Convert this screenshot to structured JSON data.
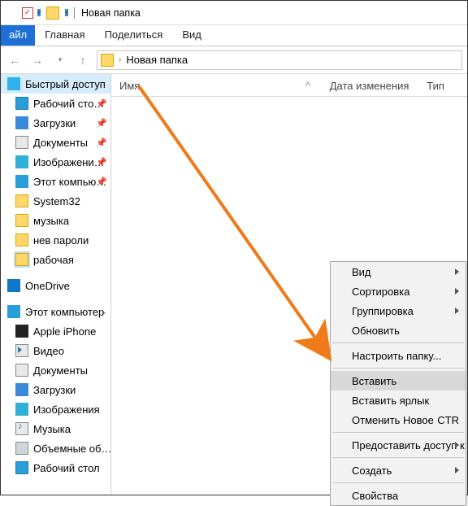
{
  "window": {
    "title": "Новая папка"
  },
  "ribbon": {
    "file": "айл",
    "tabs": [
      "Главная",
      "Поделиться",
      "Вид"
    ]
  },
  "address": {
    "path": "Новая папка"
  },
  "columns": {
    "name": "Имя",
    "date": "Дата изменения",
    "type": "Тип",
    "sort_indicator": "^"
  },
  "sidebar": {
    "quick": {
      "label": "Быстрый доступ"
    },
    "quick_items": [
      {
        "label": "Рабочий сто…",
        "pin": true,
        "icon": "desk"
      },
      {
        "label": "Загрузки",
        "pin": true,
        "icon": "down"
      },
      {
        "label": "Документы",
        "pin": true,
        "icon": "docs"
      },
      {
        "label": "Изображени…",
        "pin": true,
        "icon": "pics"
      },
      {
        "label": "Этот компью…",
        "pin": true,
        "icon": "pc"
      },
      {
        "label": "System32",
        "pin": false,
        "icon": "fold"
      },
      {
        "label": "музыка",
        "pin": false,
        "icon": "fold"
      },
      {
        "label": "нев пароли",
        "pin": false,
        "icon": "fold"
      },
      {
        "label": "рабочая",
        "pin": false,
        "icon": "fold",
        "selected": true
      }
    ],
    "onedrive": {
      "label": "OneDrive"
    },
    "thispc": {
      "label": "Этот компьютер"
    },
    "pc_items": [
      {
        "label": "Apple iPhone",
        "icon": "iph"
      },
      {
        "label": "Видео",
        "icon": "vid"
      },
      {
        "label": "Документы",
        "icon": "docs"
      },
      {
        "label": "Загрузки",
        "icon": "down"
      },
      {
        "label": "Изображения",
        "icon": "pics"
      },
      {
        "label": "Музыка",
        "icon": "mus"
      },
      {
        "label": "Объемные об…",
        "icon": "hdd"
      },
      {
        "label": "Рабочий стол",
        "icon": "desk"
      }
    ]
  },
  "context_menu": {
    "items": [
      {
        "label": "Вид",
        "sub": true
      },
      {
        "label": "Сортировка",
        "sub": true
      },
      {
        "label": "Группировка",
        "sub": true
      },
      {
        "label": "Обновить"
      },
      {
        "sep": true
      },
      {
        "label": "Настроить папку..."
      },
      {
        "sep": true
      },
      {
        "label": "Вставить",
        "hl": true
      },
      {
        "label": "Вставить ярлык"
      },
      {
        "label": "Отменить Новое",
        "shortcut": "CTR"
      },
      {
        "sep": true
      },
      {
        "label": "Предоставить доступ к",
        "sub": true
      },
      {
        "sep": true
      },
      {
        "label": "Создать",
        "sub": true
      },
      {
        "sep": true
      },
      {
        "label": "Свойства"
      }
    ]
  }
}
